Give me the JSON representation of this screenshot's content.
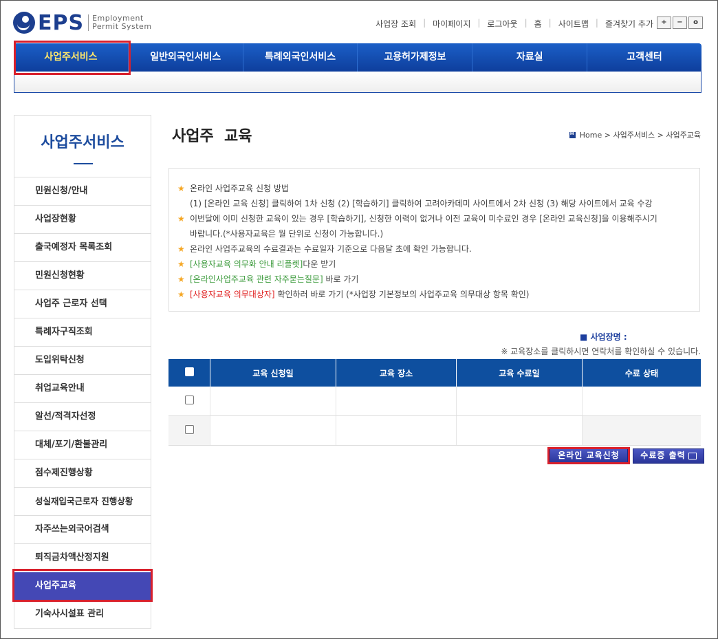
{
  "header": {
    "logo_text": "EPS",
    "logo_sub1": "Employment",
    "logo_sub2": "Permit System",
    "top_links": [
      "사업장 조회",
      "마이페이지",
      "로그아웃",
      "홈",
      "사이트맵",
      "즐겨찾기 추가"
    ],
    "zoom": [
      "+",
      "−",
      "o"
    ]
  },
  "mainnav": [
    "사업주서비스",
    "일반외국인서비스",
    "특례외국인서비스",
    "고용허가제정보",
    "자료실",
    "고객센터"
  ],
  "sidebar": {
    "title": "사업주서비스",
    "items": [
      "민원신청/안내",
      "사업장현황",
      "출국예정자 목록조회",
      "민원신청현황",
      "사업주 근로자 선택",
      "특례자구직조회",
      "도입위탁신청",
      "취업교육안내",
      "알선/적격자선정",
      "대체/포기/환불관리",
      "점수제진행상황",
      "성실재입국근로자 진행상황",
      "자주쓰는외국어검색",
      "퇴직금차액산정지원",
      "사업주교육",
      "기숙사시설표 관리"
    ]
  },
  "page": {
    "title": "사업주  교육",
    "breadcrumb": "Home > 사업주서비스 > 사업주교육"
  },
  "notice": {
    "l1": "온라인 사업주교육 신청 방법",
    "l2": "(1) [온라인 교육 신청] 클릭하여 1차 신청 (2) [학습하기] 클릭하여 고려아카데미 사이트에서 2차 신청 (3) 해당 사이트에서 교육 수강",
    "l3": "이번달에 이미 신청한 교육이 있는 경우 [학습하기], 신청한 이력이 없거나 이전 교육이 미수료인 경우 [온라인 교육신청]을 이용해주시기",
    "l4": "바랍니다.(*사용자교육은 월 단위로 신청이 가능합니다.)",
    "l5": "온라인 사업주교육의 수료결과는 수료일자 기준으로 다음달 초에 확인 가능합니다.",
    "l6_link": "[사용자교육 의무화 안내 리플렛]",
    "l6_rest": "다운 받기",
    "l7_link": "[온라인사업주교육 관련 자주묻는질문]",
    "l7_rest": " 바로 가기",
    "l8_link": "[사용자교육 의무대상자]",
    "l8_rest": " 확인하러 바로 가기 (*사업장 기본정보의 사업주교육 의무대상 항목 확인)"
  },
  "bizname_label": "■ 사업장명 :",
  "hint": "※ 교육장소를 클릭하시면 연락처를 확인하실 수 있습니다.",
  "table": {
    "headers": [
      "교육 신청일",
      "교육 장소",
      "교육 수료일",
      "수료 상태"
    ]
  },
  "buttons": {
    "apply": "온라인 교육신청",
    "print": "수료증 출력"
  }
}
